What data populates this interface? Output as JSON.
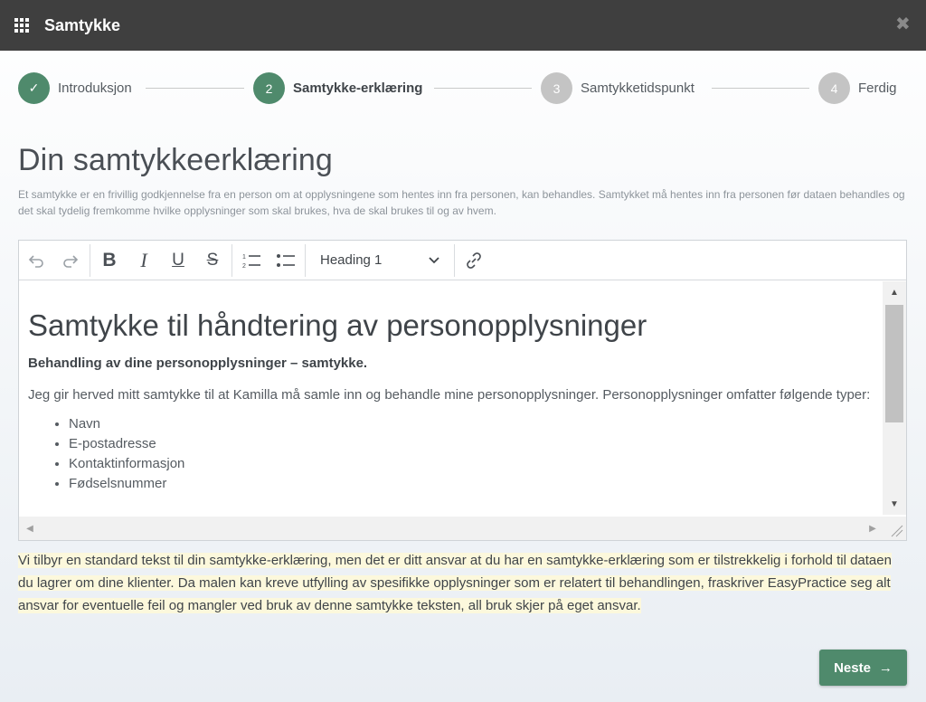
{
  "header": {
    "title": "Samtykke"
  },
  "stepper": {
    "steps": [
      {
        "number": "✓",
        "label": "Introduksjon"
      },
      {
        "number": "2",
        "label": "Samtykke-erklæring"
      },
      {
        "number": "3",
        "label": "Samtykketidspunkt"
      },
      {
        "number": "4",
        "label": "Ferdig"
      }
    ]
  },
  "page": {
    "title": "Din samtykkeerklæring",
    "description": "Et samtykke er en frivillig godkjennelse fra en person om at opplysningene som hentes inn fra personen, kan behandles. Samtykket må hentes inn fra personen før dataen behandles og det skal tydelig fremkomme hvilke opplysninger som skal brukes, hva de skal brukes til og av hvem."
  },
  "editor": {
    "toolbar": {
      "heading_select": "Heading 1"
    },
    "content": {
      "heading": "Samtykke til håndtering av personopplysninger",
      "subheading": "Behandling av dine personopplysninger – samtykke.",
      "paragraph": "Jeg gir herved mitt samtykke til at Kamilla må samle inn og behandle mine personopplysninger. Personopplysninger omfatter følgende typer:",
      "list": [
        "Navn",
        "E-postadresse",
        "Kontaktinformasjon",
        "Fødselsnummer"
      ]
    }
  },
  "notice": " Vi tilbyr en standard tekst til din samtykke-erklæring, men det er ditt ansvar at du har en samtykke-erklæring som er tilstrekkelig i forhold til dataen du lagrer om dine klienter. Da malen kan kreve utfylling av spesifikke opplysninger som er relatert til behandlingen, fraskriver EasyPractice seg alt ansvar for eventuelle feil og mangler ved bruk av denne samtykke teksten, all bruk skjer på eget ansvar.",
  "actions": {
    "next_label": "Neste",
    "next_arrow": "→"
  },
  "colors": {
    "accent": "#4f8a6c",
    "header_bg": "#3f3f3f",
    "notice_highlight": "#fcf8dc",
    "step_inactive": "#c4c4c4"
  }
}
